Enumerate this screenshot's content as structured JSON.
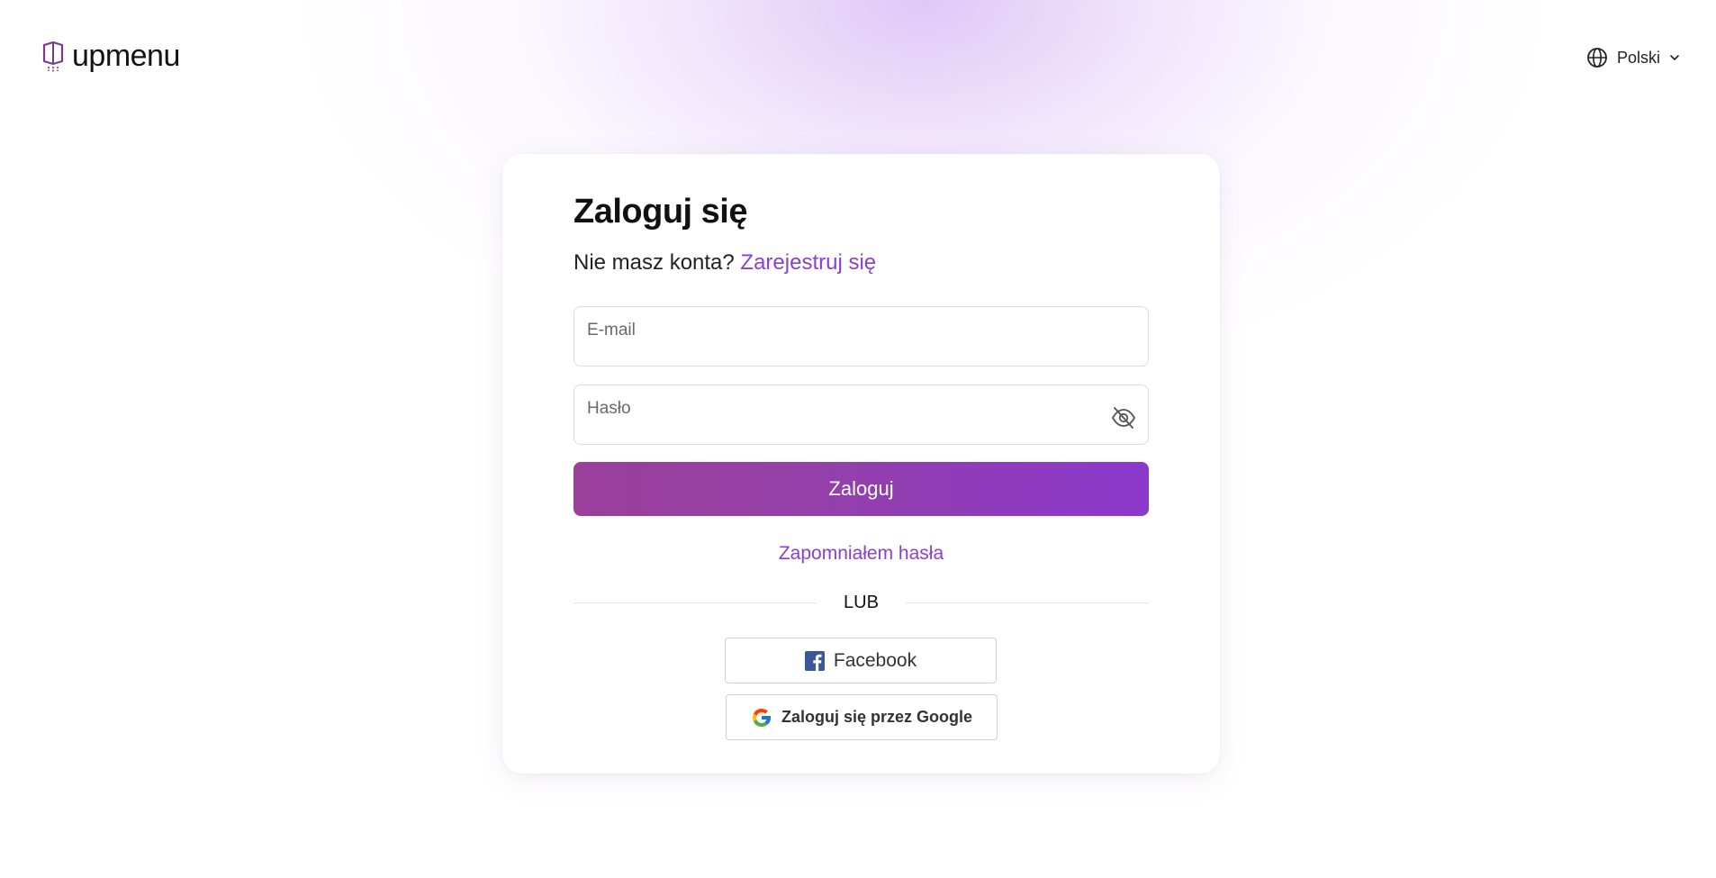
{
  "header": {
    "logo_text": "upmenu",
    "language_label": "Polski"
  },
  "login": {
    "title": "Zaloguj się",
    "no_account_text": "Nie masz konta?",
    "register_link": "Zarejestruj się",
    "email_placeholder": "E-mail",
    "email_value": "",
    "password_placeholder": "Hasło",
    "password_value": "",
    "submit_label": "Zaloguj",
    "forgot_link": "Zapomniałem hasła",
    "divider_text": "LUB",
    "facebook_label": "Facebook",
    "google_label": "Zaloguj się przez Google"
  },
  "colors": {
    "accent": "#8a3fd0",
    "button_gradient_start": "#9a3f9a",
    "button_gradient_end": "#8b38cc",
    "facebook_blue": "#3b5998"
  },
  "icons": {
    "logo": "upmenu-logo-icon",
    "language": "globe-icon",
    "language_dropdown": "chevron-down-icon",
    "password_toggle": "eye-off-icon",
    "facebook": "facebook-icon",
    "google": "google-icon"
  }
}
